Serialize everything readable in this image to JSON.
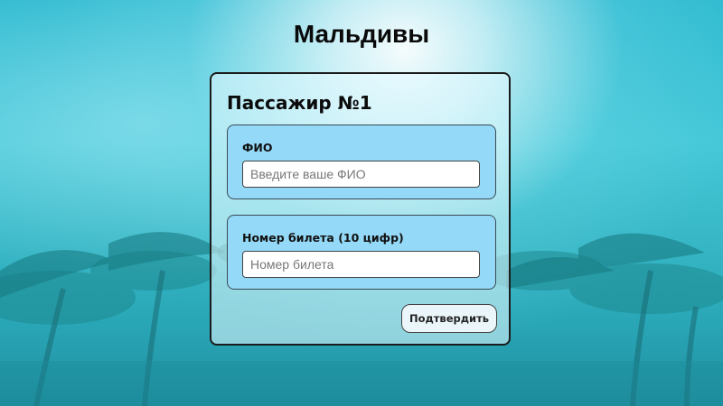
{
  "page": {
    "title": "Мальдивы"
  },
  "form": {
    "title": "Пассажир №1",
    "full_name": {
      "label": "ФИО",
      "value": "",
      "placeholder": "Введите ваше ФИО"
    },
    "ticket_number": {
      "label": "Номер билета (10 цифр)",
      "value": "",
      "placeholder": "Номер билета"
    },
    "submit_label": "Подтвердить"
  },
  "colors": {
    "sky": "#3fc2d4",
    "field_background": "#94d9f7",
    "card_border": "#1b1b1b"
  }
}
